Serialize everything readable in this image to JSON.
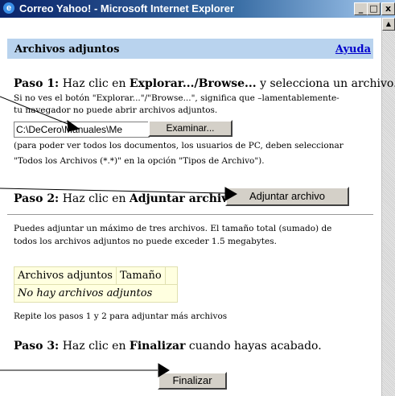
{
  "window": {
    "title": "Correo Yahoo! - Microsoft Internet Explorer",
    "minimize": "_",
    "maximize": "□",
    "close": "x"
  },
  "header": {
    "title": "Archivos adjuntos",
    "help_link": "Ayuda",
    "background": "#b9d3ee"
  },
  "step1": {
    "label": "Paso 1:",
    "text_a": "Haz clic en",
    "bold": "Explorar.../Browse...",
    "text_b": "y selecciona un archivo.",
    "note1": "Si no ves el botón \"Explorar...\"/\"Browse...\", significa que –lamentablemente-",
    "note2": "tu navegador no puede abrir archivos adjuntos.",
    "file_value": "C:\\DeCero\\Manuales\\Me",
    "browse_button": "Examinar...",
    "hint1": "(para poder ver todos los documentos, los usuarios de PC, deben seleccionar",
    "hint2": "\"Todos los Archivos (*.*)\" en la opción \"Tipos de Archivo\")."
  },
  "step2": {
    "label": "Paso 2:",
    "text_a": "Haz clic en",
    "bold": "Adjuntar archivo.",
    "attach_button": "Adjuntar archivo",
    "info1": "Puedes adjuntar un máximo de tres archivos. El tamaño total (sumado) de",
    "info2": "todos los archivos adjuntos no puede exceder 1.5 megabytes."
  },
  "attachments_table": {
    "columns": [
      "Archivos adjuntos",
      "Tamaño",
      ""
    ],
    "empty_message": "No hay archivos adjuntos",
    "background": "#ffffe0"
  },
  "repeat_note": "Repite los pasos 1 y 2 para adjuntar más archivos",
  "step3": {
    "label": "Paso 3:",
    "text_a": "Haz clic en",
    "bold": "Finalizar",
    "text_b": "cuando hayas acabado.",
    "finish_button": "Finalizar"
  }
}
